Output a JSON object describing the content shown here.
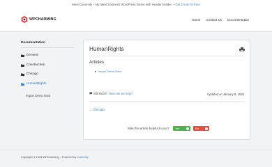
{
  "topbar": {
    "text": "Meet Cuenmify – My latest business WordPress theme with Header builder. –",
    "link": "Get it now for free!"
  },
  "header": {
    "logo_text": "WPCHARMING",
    "nav": [
      "Home",
      "Contact Us",
      "Documentation"
    ]
  },
  "sidebar": {
    "heading": "Documentation",
    "items": [
      {
        "label": "General"
      },
      {
        "label": "Construction"
      },
      {
        "label": "Chicago"
      },
      {
        "label": "HumanRights"
      }
    ],
    "sub_item": "Import Demo Data"
  },
  "article": {
    "title": "HumanRights",
    "section": "Articles",
    "links": [
      "Import Demo Data"
    ],
    "stuck_text": "Still stuck?",
    "help_link": "How can we help?",
    "updated": "Updated on January 8, 2020",
    "prev_link": "← Chicago",
    "feedback_question": "Was this article helpful to you?",
    "yes_label": "Yes",
    "no_label": "No"
  },
  "footer": {
    "text": "Copyright © 2024 WPCharming – Powered by",
    "link": "Cuenmify"
  },
  "colors": {
    "accent": "#2f80c8",
    "yes": "#4caf50",
    "no": "#e74c3c",
    "logo": "#e0433b"
  }
}
